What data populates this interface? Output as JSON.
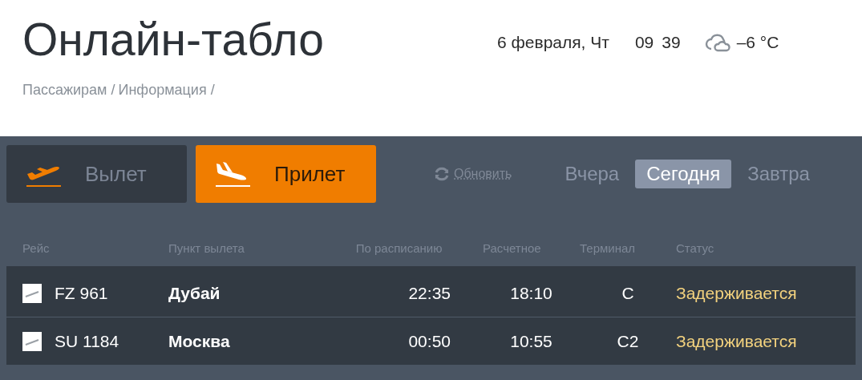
{
  "header": {
    "title": "Онлайн-табло",
    "date": "6 февраля, Чт",
    "hours": "09",
    "minutes": "39",
    "temperature": "–6 °C",
    "breadcrumbs": [
      "Пассажирам /",
      "Информация /"
    ]
  },
  "direction_tabs": [
    {
      "label": "Вылет",
      "kind": "departure",
      "selected": false
    },
    {
      "label": "Прилет",
      "kind": "arrival",
      "selected": true
    }
  ],
  "refresh": "Обновить",
  "day_tabs": [
    {
      "label": "Вчера",
      "selected": false
    },
    {
      "label": "Сегодня",
      "selected": true
    },
    {
      "label": "Завтра",
      "selected": false
    }
  ],
  "table": {
    "columns": [
      "Рейс",
      "Пункт вылета",
      "По расписанию",
      "Расчетное",
      "Терминал",
      "Статус"
    ],
    "rows": [
      {
        "flight": "FZ 961",
        "city": "Дубай",
        "scheduled": "22:35",
        "estimated": "18:10",
        "terminal": "C",
        "status": "Задерживается"
      },
      {
        "flight": "SU 1184",
        "city": "Москва",
        "scheduled": "00:50",
        "estimated": "10:55",
        "terminal": "C2",
        "status": "Задерживается"
      }
    ]
  }
}
